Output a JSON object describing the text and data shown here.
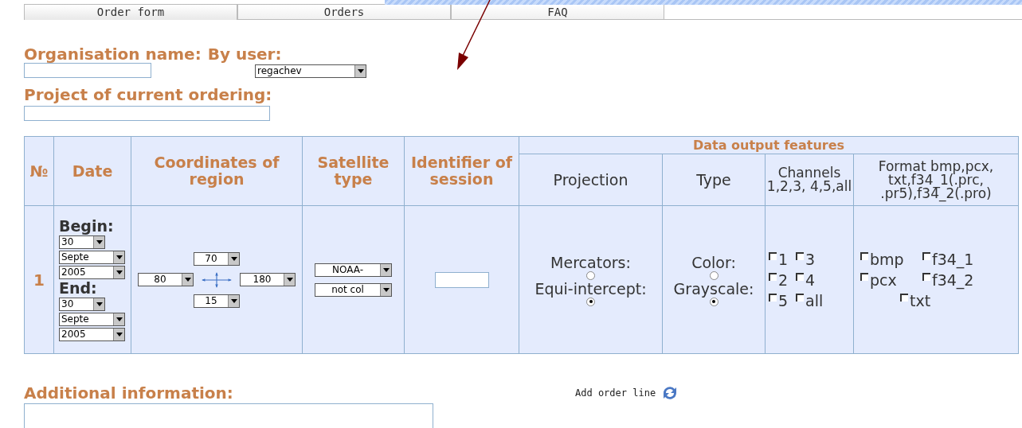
{
  "tabs": [
    {
      "label": "Order form",
      "selected": true
    },
    {
      "label": "Orders",
      "selected": false
    },
    {
      "label": "FAQ",
      "selected": false
    }
  ],
  "organisation": {
    "label": "Organisation name:"
  },
  "user": {
    "label": "By user:",
    "value": "regachev"
  },
  "project": {
    "label": "Project of current ordering:"
  },
  "table": {
    "columns": [
      "№",
      "Date",
      "Coordinates of region",
      "Satellite type",
      "Identifier of session"
    ],
    "group_header": "Data output features",
    "sub_columns": [
      "Projection",
      "Type",
      "Channels 1,2,3, 4,5,all",
      "Format bmp,pcx, txt,f34_1(.prc, .pr5),f34_2(.pro)"
    ],
    "rows": [
      {
        "number": "1",
        "begin_label": "Begin:",
        "begin": [
          "30",
          "Septe",
          "2005"
        ],
        "end_label": "End:",
        "end": [
          "30",
          "Septe",
          "2005"
        ],
        "coordinates": {
          "north": "70",
          "west": "80",
          "east": "180",
          "south": "15"
        },
        "satellite": [
          "NOAA-",
          "not col"
        ],
        "projection": [
          {
            "label": "Mercators:",
            "selected": false
          },
          {
            "label": "Equi-intercept:",
            "selected": true
          }
        ],
        "type": [
          {
            "label": "Color:",
            "selected": false
          },
          {
            "label": "Grayscale:",
            "selected": true
          }
        ],
        "channels": [
          {
            "label": "1",
            "checked": false
          },
          {
            "label": "3",
            "checked": false
          },
          {
            "label": "2",
            "checked": false
          },
          {
            "label": "4",
            "checked": false
          },
          {
            "label": "5",
            "checked": false
          },
          {
            "label": "all",
            "checked": false
          }
        ],
        "formats": [
          {
            "label": "bmp",
            "checked": false
          },
          {
            "label": "f34_1",
            "checked": false
          },
          {
            "label": "pcx",
            "checked": false
          },
          {
            "label": "f34_2",
            "checked": false
          },
          {
            "label": "txt",
            "checked": false
          }
        ]
      }
    ]
  },
  "additional": {
    "label": "Additional information:"
  },
  "add_line": {
    "label": "Add order line"
  }
}
